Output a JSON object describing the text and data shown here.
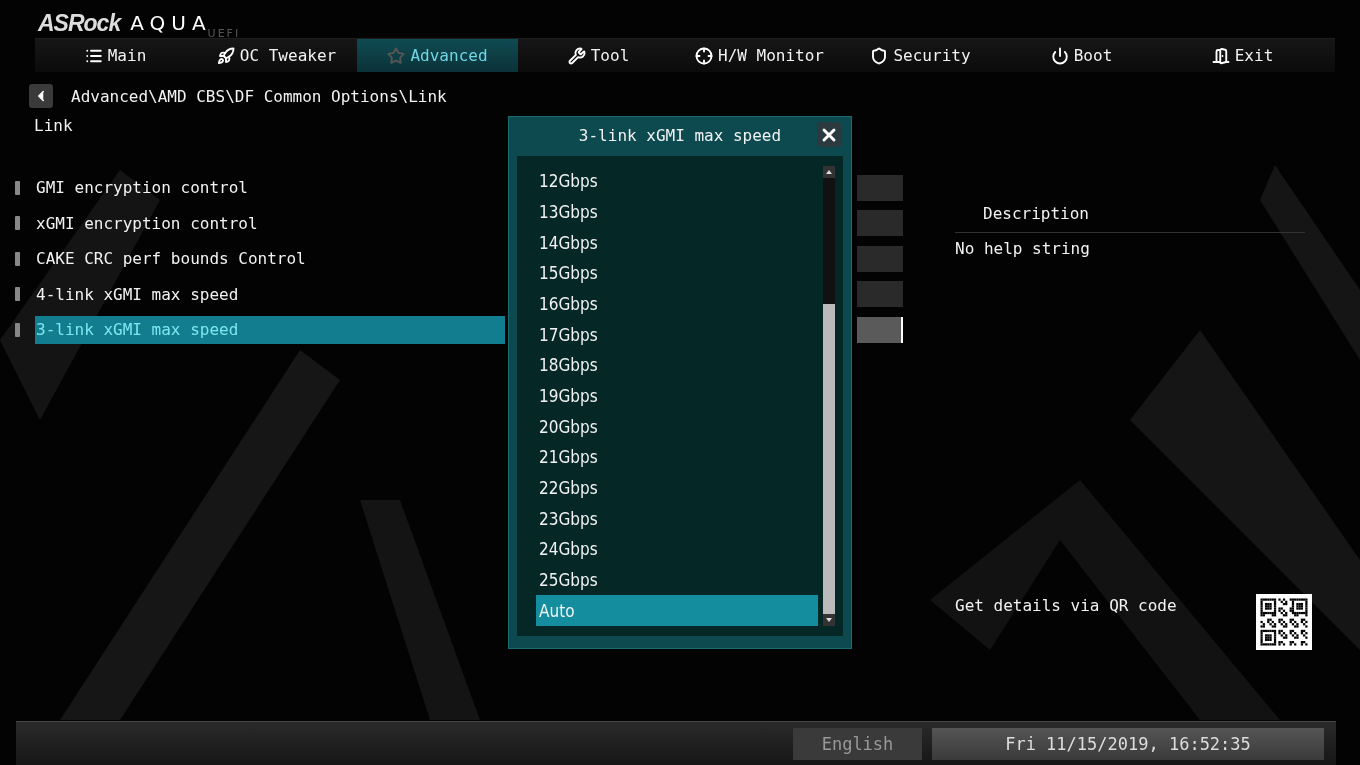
{
  "logo": {
    "brand": "ASRock",
    "product": "AQUA",
    "suffix": "UEFI"
  },
  "tabs": [
    {
      "label": "Main",
      "selected": false
    },
    {
      "label": "OC Tweaker",
      "selected": false
    },
    {
      "label": "Advanced",
      "selected": true
    },
    {
      "label": "Tool",
      "selected": false
    },
    {
      "label": "H/W Monitor",
      "selected": false
    },
    {
      "label": "Security",
      "selected": false
    },
    {
      "label": "Boot",
      "selected": false
    },
    {
      "label": "Exit",
      "selected": false
    }
  ],
  "breadcrumb": "Advanced\\AMD CBS\\DF Common Options\\Link",
  "page_title": "Link",
  "settings": [
    {
      "label": "GMI encryption control",
      "selected": false
    },
    {
      "label": "xGMI encryption control",
      "selected": false
    },
    {
      "label": "CAKE CRC perf bounds Control",
      "selected": false
    },
    {
      "label": "4-link xGMI max speed",
      "selected": false
    },
    {
      "label": "3-link xGMI max speed",
      "selected": true
    }
  ],
  "description": {
    "title": "Description",
    "text": "No help string",
    "qr_label": "Get details via QR code"
  },
  "dialog": {
    "title": "3-link xGMI max speed",
    "options": [
      {
        "label": "12Gbps",
        "selected": false
      },
      {
        "label": "13Gbps",
        "selected": false
      },
      {
        "label": "14Gbps",
        "selected": false
      },
      {
        "label": "15Gbps",
        "selected": false
      },
      {
        "label": "16Gbps",
        "selected": false
      },
      {
        "label": "17Gbps",
        "selected": false
      },
      {
        "label": "18Gbps",
        "selected": false
      },
      {
        "label": "19Gbps",
        "selected": false
      },
      {
        "label": "20Gbps",
        "selected": false
      },
      {
        "label": "21Gbps",
        "selected": false
      },
      {
        "label": "22Gbps",
        "selected": false
      },
      {
        "label": "23Gbps",
        "selected": false
      },
      {
        "label": "24Gbps",
        "selected": false
      },
      {
        "label": "25Gbps",
        "selected": false
      },
      {
        "label": "Auto",
        "selected": true
      }
    ]
  },
  "status_bar": {
    "language": "English",
    "datetime": "Fri 11/15/2019, 16:52:35"
  }
}
